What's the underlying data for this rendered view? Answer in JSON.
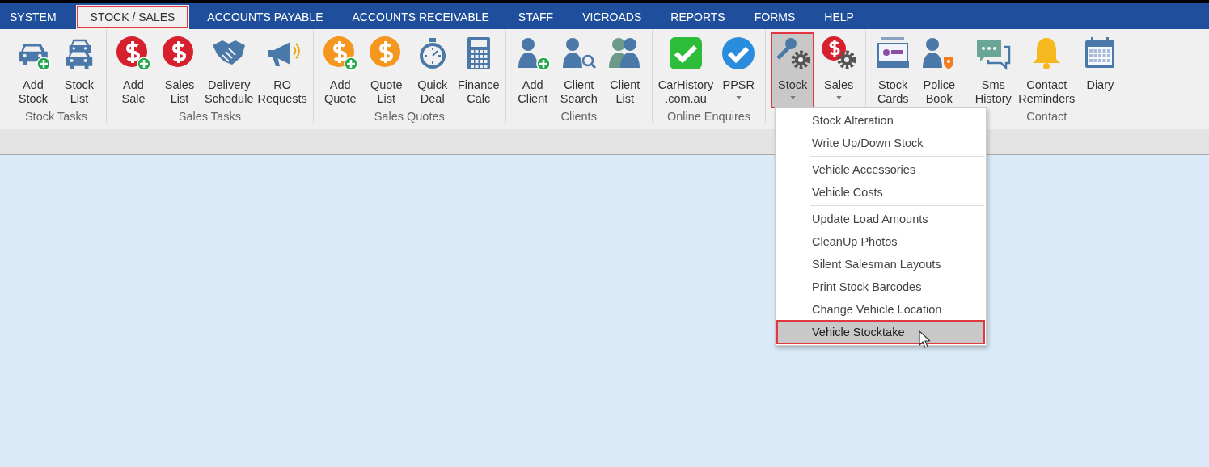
{
  "menu_bar": {
    "tabs": [
      {
        "label": "SYSTEM",
        "selected": false,
        "highlighted": false
      },
      {
        "label": "STOCK / SALES",
        "selected": true,
        "highlighted": true
      },
      {
        "label": "ACCOUNTS PAYABLE",
        "selected": false,
        "highlighted": false
      },
      {
        "label": "ACCOUNTS RECEIVABLE",
        "selected": false,
        "highlighted": false
      },
      {
        "label": "STAFF",
        "selected": false,
        "highlighted": false
      },
      {
        "label": "VICROADS",
        "selected": false,
        "highlighted": false
      },
      {
        "label": "REPORTS",
        "selected": false,
        "highlighted": false
      },
      {
        "label": "FORMS",
        "selected": false,
        "highlighted": false
      },
      {
        "label": "HELP",
        "selected": false,
        "highlighted": false
      }
    ]
  },
  "ribbon": {
    "groups": [
      {
        "label": "Stock Tasks",
        "buttons": [
          {
            "lines": [
              "Add",
              "Stock"
            ],
            "pressed": false,
            "highlighted": false
          },
          {
            "lines": [
              "Stock",
              "List"
            ],
            "pressed": false,
            "highlighted": false
          }
        ]
      },
      {
        "label": "Sales Tasks",
        "buttons": [
          {
            "lines": [
              "Add",
              "Sale"
            ],
            "pressed": false,
            "highlighted": false
          },
          {
            "lines": [
              "Sales",
              "List"
            ],
            "pressed": false,
            "highlighted": false
          },
          {
            "lines": [
              "Delivery",
              "Schedule"
            ],
            "pressed": false,
            "highlighted": false
          },
          {
            "lines": [
              "RO",
              "Requests"
            ],
            "pressed": false,
            "highlighted": false
          }
        ]
      },
      {
        "label": "Sales Quotes",
        "buttons": [
          {
            "lines": [
              "Add",
              "Quote"
            ],
            "pressed": false,
            "highlighted": false
          },
          {
            "lines": [
              "Quote",
              "List"
            ],
            "pressed": false,
            "highlighted": false
          },
          {
            "lines": [
              "Quick",
              "Deal"
            ],
            "pressed": false,
            "highlighted": false
          },
          {
            "lines": [
              "Finance",
              "Calc"
            ],
            "pressed": false,
            "highlighted": false
          }
        ]
      },
      {
        "label": "Clients",
        "buttons": [
          {
            "lines": [
              "Add",
              "Client"
            ],
            "pressed": false,
            "highlighted": false
          },
          {
            "lines": [
              "Client",
              "Search"
            ],
            "pressed": false,
            "highlighted": false
          },
          {
            "lines": [
              "Client",
              "List"
            ],
            "pressed": false,
            "highlighted": false
          }
        ]
      },
      {
        "label": "Online Enquires",
        "buttons": [
          {
            "lines": [
              "CarHistory",
              ".com.au"
            ],
            "pressed": false,
            "highlighted": false
          },
          {
            "lines": [
              "PPSR"
            ],
            "dropdown": true,
            "pressed": false,
            "highlighted": false
          }
        ]
      },
      {
        "buttons": [
          {
            "lines": [
              "Stock"
            ],
            "dropdown": true,
            "pressed": true,
            "highlighted": true
          },
          {
            "lines": [
              "Sales"
            ],
            "dropdown": true,
            "pressed": false,
            "highlighted": false
          }
        ]
      },
      {
        "buttons": [
          {
            "lines": [
              "Stock",
              "Cards"
            ],
            "pressed": false,
            "highlighted": false
          },
          {
            "lines": [
              "Police",
              "Book"
            ],
            "pressed": false,
            "highlighted": false
          }
        ]
      },
      {
        "label": "Contact",
        "buttons": [
          {
            "lines": [
              "Sms",
              "History"
            ],
            "pressed": false,
            "highlighted": false
          },
          {
            "lines": [
              "Contact",
              "Reminders"
            ],
            "pressed": false,
            "highlighted": false
          },
          {
            "lines": [
              "Diary"
            ],
            "dropdown": false,
            "pressed": false,
            "highlighted": false
          }
        ]
      }
    ]
  },
  "dropdown_menu": {
    "sections": [
      {
        "items": [
          {
            "label": "Stock Alteration",
            "selected": false,
            "highlighted": false
          },
          {
            "label": "Write Up/Down Stock",
            "selected": false,
            "highlighted": false
          }
        ]
      },
      {
        "items": [
          {
            "label": "Vehicle Accessories",
            "selected": false,
            "highlighted": false
          },
          {
            "label": "Vehicle Costs",
            "selected": false,
            "highlighted": false
          }
        ]
      },
      {
        "items": [
          {
            "label": "Update Load Amounts",
            "selected": false,
            "highlighted": false
          },
          {
            "label": "CleanUp Photos",
            "selected": false,
            "highlighted": false
          },
          {
            "label": "Silent Salesman Layouts",
            "selected": false,
            "highlighted": false
          },
          {
            "label": "Print Stock Barcodes",
            "selected": false,
            "highlighted": false
          },
          {
            "label": "Change Vehicle Location",
            "selected": false,
            "highlighted": false
          },
          {
            "label": "Vehicle Stocktake",
            "selected": true,
            "highlighted": true
          }
        ]
      }
    ]
  }
}
